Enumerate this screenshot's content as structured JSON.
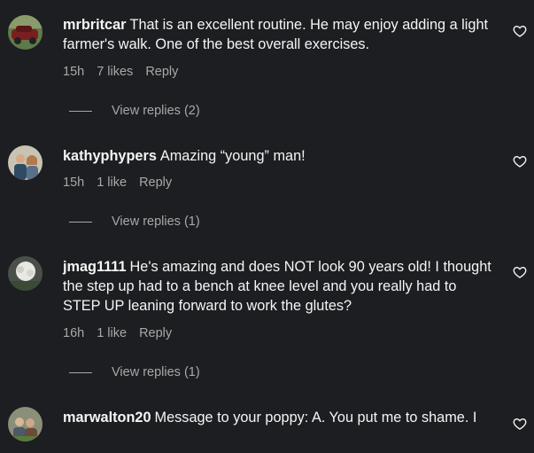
{
  "comments": [
    {
      "username": "mrbritcar",
      "text": "That is an excellent routine. He may enjoy adding a light farmer's walk. One of the best overall exercises.",
      "time": "15h",
      "likes": "7 likes",
      "reply_label": "Reply",
      "view_replies": "View replies (2)"
    },
    {
      "username": "kathyphypers",
      "text": "Amazing “young” man!",
      "time": "15h",
      "likes": "1 like",
      "reply_label": "Reply",
      "view_replies": "View replies (1)"
    },
    {
      "username": "jmag1111",
      "text": "He's amazing and does NOT look 90 years old! I thought the step up had to a bench at knee level and you really had to STEP UP leaning forward to work the glutes?",
      "time": "16h",
      "likes": "1 like",
      "reply_label": "Reply",
      "view_replies": "View replies (1)"
    },
    {
      "username": "marwalton20",
      "text": "Message to your poppy: A. You put me to shame. I"
    }
  ],
  "colors": {
    "background": "#1c1e21",
    "text": "#f5f5f5",
    "muted": "#a8a8a8"
  }
}
